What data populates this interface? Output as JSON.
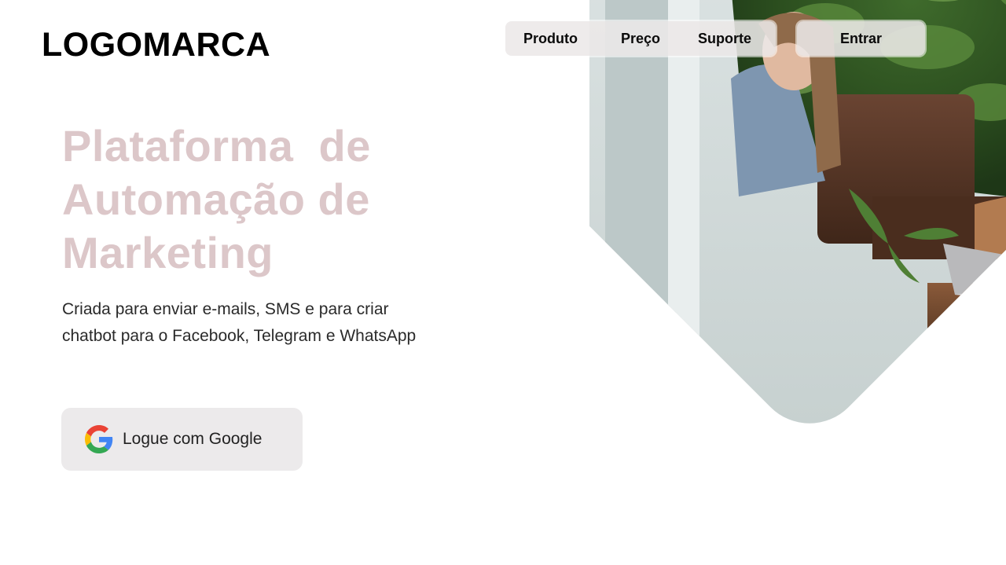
{
  "header": {
    "logo": "LOGOMARCA",
    "nav": [
      {
        "label": "Produto"
      },
      {
        "label": "Preço"
      },
      {
        "label": "Suporte"
      }
    ],
    "login_label": "Entrar"
  },
  "hero": {
    "title_lines": [
      "Plataforma  de",
      "Automação de",
      "Marketing"
    ],
    "subtitle_lines": [
      "Criada para enviar e-mails, SMS e para criar",
      "chatbot para o Facebook, Telegram e WhatsApp"
    ],
    "google_button_label": "Logue com Google",
    "google_icon": "google-g-icon"
  },
  "photo": {
    "subject": "two women working on a laptop on a leather sofa in front of a green plant wall"
  },
  "colors": {
    "title": "#dcc7c9",
    "nav_pill_bg": "#ece8e8",
    "button_bg": "#eceaeb",
    "text": "#2a2a2a"
  }
}
